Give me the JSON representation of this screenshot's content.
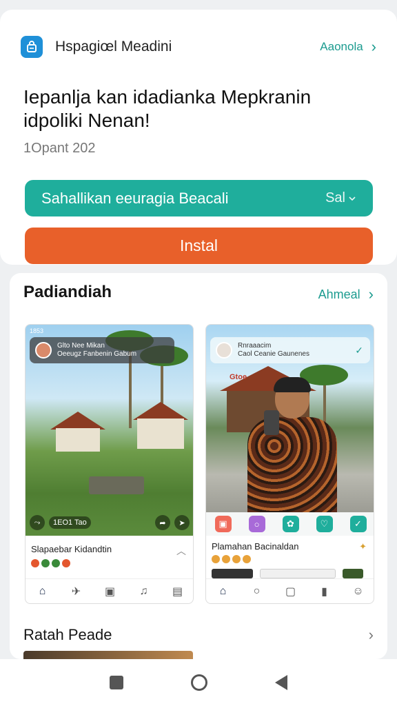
{
  "app": {
    "name": "Hspagiœl Meadini",
    "link_label": "Aaonola"
  },
  "headline": "Iepanlja kan idadianka Mepkranin idpoliki Nenan!",
  "date": "1Opant 202",
  "buttons": {
    "translate_label": "Sahallikan eeuragia Beacali",
    "translate_lang": "Sal",
    "install_label": "Instal"
  },
  "screenshots_section": {
    "title": "Padiandiah",
    "link_label": "Ahmeal"
  },
  "shot1": {
    "status": "1853",
    "overlay_title": "Glto Nee Mikan",
    "overlay_sub": "Oeeugz Fanbenin Gabum",
    "media_text": "1EO1 Tao",
    "caption": "Slapaebar Kidandtin",
    "chip_colors": [
      "#e4572e",
      "#3a8a3a",
      "#3a8a3a",
      "#e4572e"
    ]
  },
  "shot2": {
    "overlay_title": "Rnraaacim",
    "overlay_sub": "Caol Ceanie Gaunenes",
    "tag": "Gtoe",
    "caption": "Plamahan Bacinaldan",
    "chip_colors": [
      "#e8a23a",
      "#e8a23a",
      "#e8a23a",
      "#e8a23a"
    ],
    "icon_colors": [
      "#f06a5a",
      "#a86ad8",
      "#1fae9c",
      "#1fae9c",
      "#1fae9c"
    ]
  },
  "rating_section": {
    "title": "Ratah Peade"
  },
  "icons": {
    "app": "bag-icon",
    "chevron": "chevron-right-icon",
    "dropdown": "chevron-down-icon",
    "system_nav": [
      "recent-apps-square-icon",
      "home-circle-icon",
      "back-triangle-icon"
    ]
  },
  "colors": {
    "teal": "#1fae9c",
    "orange": "#e8602a",
    "link": "#1b9b8f"
  }
}
